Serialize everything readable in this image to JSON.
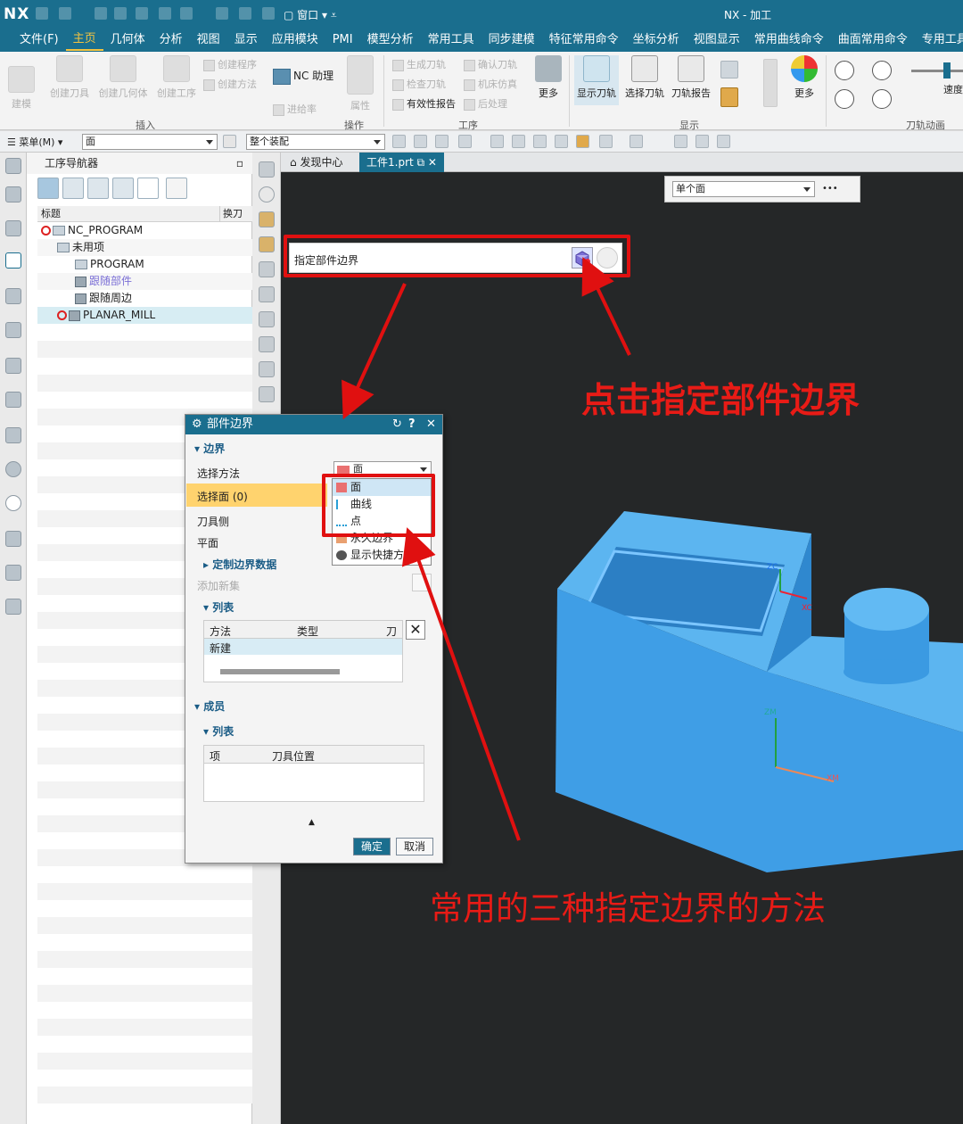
{
  "titlebar": {
    "logo": "NX",
    "window_menu": "窗口",
    "title": "NX - 加工"
  },
  "menu_tabs": [
    "文件(F)",
    "主页",
    "几何体",
    "分析",
    "视图",
    "显示",
    "应用模块",
    "PMI",
    "模型分析",
    "常用工具",
    "同步建模",
    "特征常用命令",
    "坐标分析",
    "视图显示",
    "常用曲线命令",
    "曲面常用命令",
    "专用工具"
  ],
  "active_tab": "主页",
  "ribbon": {
    "buttons": {
      "build": "建模",
      "create_tool": "创建刀具",
      "create_geometry": "创建几何体",
      "create_operation": "创建工序",
      "create_program": "创建程序",
      "create_method": "创建方法",
      "nc_assistant": "NC 助理",
      "feed_rate": "进给率",
      "properties": "属性",
      "generate_path": "生成刀轨",
      "verify_path": "确认刀轨",
      "check_path": "检查刀轨",
      "machine_sim": "机床仿真",
      "validity_report": "有效性报告",
      "post_process": "后处理",
      "more1": "更多",
      "show_path": "显示刀轨",
      "select_path": "选择刀轨",
      "path_report": "刀轨报告",
      "more2": "更多",
      "speed": "速度"
    },
    "groups": {
      "insert": "插入",
      "operation": "操作",
      "process": "工序",
      "display": "显示",
      "animation": "刀轨动画"
    }
  },
  "cmdbar": {
    "menu": "菜单(M)",
    "filter": "面",
    "assembly": "整个装配"
  },
  "navigator": {
    "title": "工序导航器",
    "col_title": "标题",
    "col_tool": "换刀",
    "rows": [
      "NC_PROGRAM",
      "未用项",
      "PROGRAM",
      "跟随部件",
      "跟随周边",
      "PLANAR_MILL"
    ]
  },
  "doc_tabs": {
    "discovery": "发现中心",
    "part": "工件1.prt"
  },
  "selection": {
    "scope": "单个面",
    "more": "•••"
  },
  "specify_row": {
    "label": "指定部件边界"
  },
  "dialog": {
    "title": "部件边界",
    "help": "?",
    "close": "✕",
    "section_boundary": "边界",
    "select_method_label": "选择方法",
    "select_method_value": "面",
    "select_face": "选择面 (0)",
    "tool_side": "刀具侧",
    "plane": "平面",
    "custom_boundary": "定制边界数据",
    "add_new_set": "添加新集",
    "section_list": "列表",
    "list_cols": [
      "方法",
      "类型",
      "刀具"
    ],
    "list_row": "新建",
    "section_members": "成员",
    "members_list": "列表",
    "member_cols": [
      "项",
      "刀具位置"
    ],
    "ok": "确定",
    "cancel": "取消"
  },
  "dropdown": {
    "options": [
      "面",
      "曲线",
      "点",
      "永久边界",
      "显示快捷方"
    ]
  },
  "annotations": {
    "top": "点击指定部件边界",
    "bottom": "常用的三种指定边界的方法"
  },
  "axes": {
    "zc": "ZC",
    "xc": "XC",
    "zm": "ZM",
    "xm": "XM"
  },
  "colors": {
    "accent": "#1a6e8e",
    "annotation": "#e81b16",
    "part": "#3d9fe6",
    "viewport": "#252728"
  }
}
